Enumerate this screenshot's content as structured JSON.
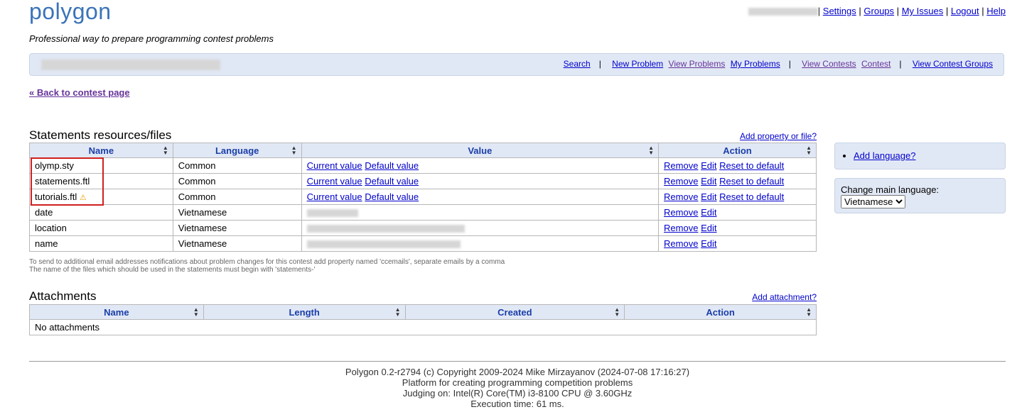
{
  "header": {
    "logo": "polygon",
    "tagline": "Professional way to prepare programming contest problems",
    "links": [
      "Settings",
      "Groups",
      "My Issues",
      "Logout",
      "Help"
    ]
  },
  "menu": {
    "links": [
      "Search",
      "New Problem",
      "View Problems",
      "My Problems",
      "View Contests",
      "Contest",
      "View Contest Groups"
    ]
  },
  "back_link": "« Back to contest page",
  "statements": {
    "title": "Statements resources/files",
    "add_link": "Add property or file?",
    "columns": [
      "Name",
      "Language",
      "Value",
      "Action"
    ],
    "rows": [
      {
        "name": "olymp.sty",
        "language": "Common",
        "value_links": [
          "Current value",
          "Default value"
        ],
        "actions": [
          "Remove",
          "Edit",
          "Reset to default"
        ]
      },
      {
        "name": "statements.ftl",
        "language": "Common",
        "value_links": [
          "Current value",
          "Default value"
        ],
        "actions": [
          "Remove",
          "Edit",
          "Reset to default"
        ]
      },
      {
        "name": "tutorials.ftl",
        "language": "Common",
        "value_links": [
          "Current value",
          "Default value"
        ],
        "actions": [
          "Remove",
          "Edit",
          "Reset to default"
        ],
        "warning_icon": "warning-icon"
      },
      {
        "name": "date",
        "language": "Vietnamese",
        "actions": [
          "Remove",
          "Edit"
        ]
      },
      {
        "name": "location",
        "language": "Vietnamese",
        "actions": [
          "Remove",
          "Edit"
        ]
      },
      {
        "name": "name",
        "language": "Vietnamese",
        "actions": [
          "Remove",
          "Edit"
        ]
      }
    ],
    "notes": [
      "To send to additional email addresses notifications about problem changes for this contest add property named 'ccemails', separate emails by a comma",
      "The name of the files which should be used in the statements must begin with 'statements-'"
    ]
  },
  "attachments": {
    "title": "Attachments",
    "add_link": "Add attachment?",
    "columns": [
      "Name",
      "Length",
      "Created",
      "Action"
    ],
    "empty": "No attachments"
  },
  "sidebar": {
    "add_language": "Add language?",
    "main_language_label": "Change main language:",
    "main_language_value": "Vietnamese"
  },
  "footer": {
    "lines": [
      "Polygon 0.2-r2794 (c) Copyright 2009-2024 Mike Mirzayanov (2024-07-08 17:16:27)",
      "Platform for creating programming competition problems",
      "Judging on: Intel(R) Core(TM) i3-8100 CPU @ 3.60GHz",
      "Execution time: 61 ms."
    ]
  }
}
